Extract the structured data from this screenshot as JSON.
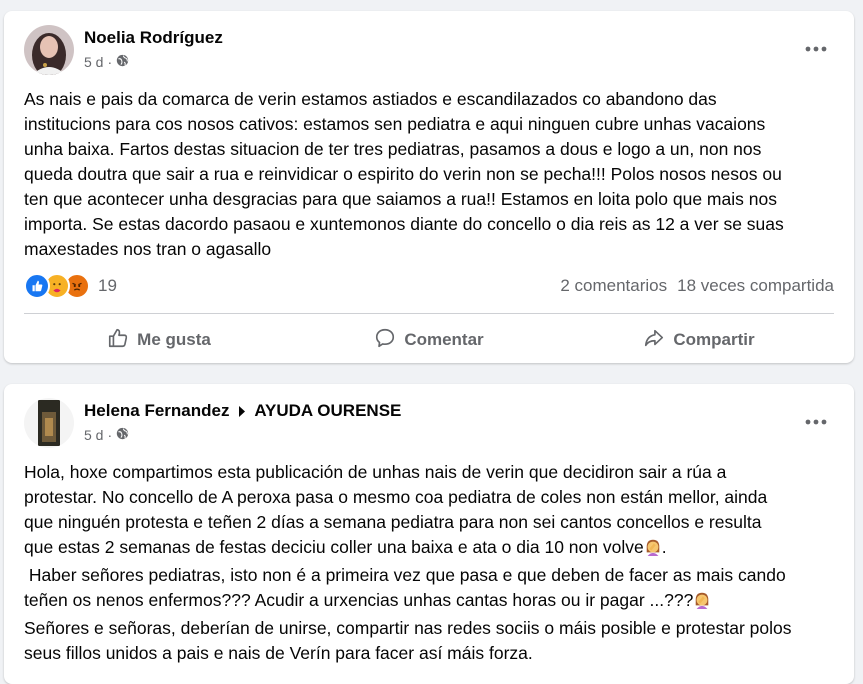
{
  "posts": [
    {
      "author": "Noelia Rodríguez",
      "time": "5 d",
      "dot": "·",
      "text": [
        "As nais e pais da comarca de verin estamos astiados e escandilazados co abandono das",
        "institucions para cos nosos cativos: estamos sen pediatra e aqui ninguen cubre unhas vacaions",
        "unha baixa. Fartos destas situacion de ter tres pediatras, pasamos a dous e logo a un, non nos",
        "queda doutra que sair a rua e reinvidicar o espirito do verin non se pecha!!! Polos nosos nesos ou",
        "ten que acontecer unha desgracias para que saiamos a rua!! Estamos en loita polo que mais nos",
        "importa. Se estas dacordo pasaou e xuntemonos  diante do concello o dia reis as 12 a ver se suas",
        "maxestades nos tran o agasallo"
      ],
      "reaction_count": "19",
      "comments": "2 comentarios",
      "shares": "18 veces compartida",
      "actions": {
        "like": "Me gusta",
        "comment": "Comentar",
        "share": "Compartir"
      },
      "colors": {
        "like": "#1877f2",
        "care": "#f7b125",
        "angry": "#e9710f"
      }
    },
    {
      "author": "Helena Fernandez",
      "group": "AYUDA OURENSE",
      "time": "5 d",
      "dot": "·",
      "text": [
        "Hola, hoxe compartimos esta publicación de unhas nais de verin que decidiron sair a rúa a",
        "protestar. No concello de  A peroxa pasa o mesmo coa pediatra de coles non están mellor, ainda",
        "que ninguén protesta e teñen 2 días a semana pediatra para non sei cantos concellos e resulta",
        "que estas 2 semanas de festas deciciu coller una baixa e ata o dia 10 non volve",
        " Haber señores pediatras, isto non é a primeira vez que pasa e que deben de facer as mais cando",
        "teñen os nenos enfermos??? Acudir a urxencias unhas cantas horas ou ir pagar ...???",
        "Señores e señoras, deberían de unirse, compartir nas redes sociis o máis posible e protestar polos",
        "seus fillos unidos a pais e nais de Verín para facer así máis forza."
      ],
      "line4_suffix": ".",
      "emoji": "woman-facepalming-icon"
    }
  ]
}
